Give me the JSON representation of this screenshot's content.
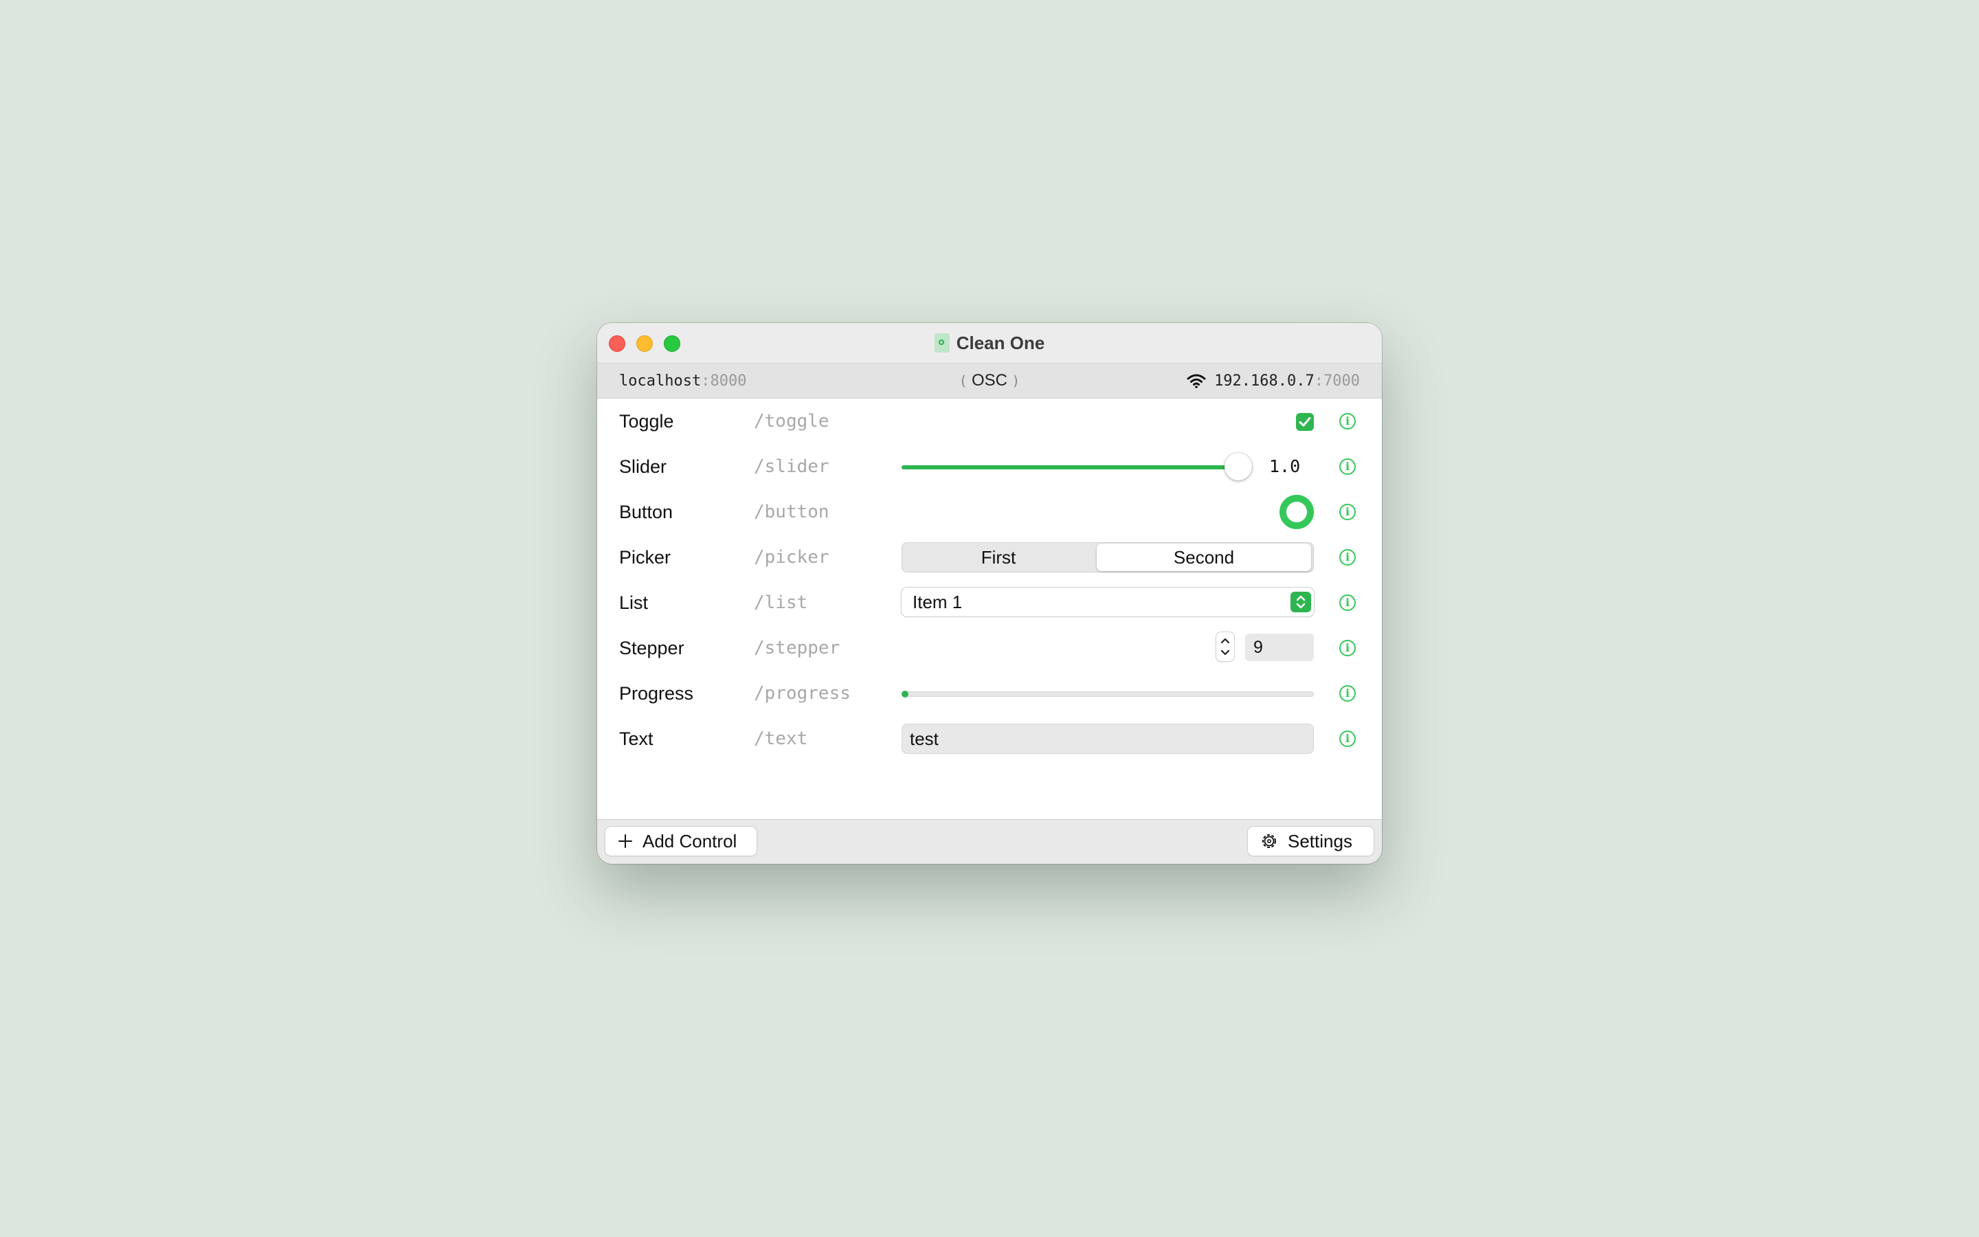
{
  "window": {
    "title": "Clean One",
    "status": {
      "local_host": "localhost",
      "local_port": ":8000",
      "protocol": "OSC",
      "remote_host": "192.168.0.7",
      "remote_port": ":7000"
    }
  },
  "controls": [
    {
      "label": "Toggle",
      "path": "/toggle",
      "type": "checkbox",
      "checked": true
    },
    {
      "label": "Slider",
      "path": "/slider",
      "type": "slider",
      "value": 1.0,
      "value_text": "1.0"
    },
    {
      "label": "Button",
      "path": "/button",
      "type": "button"
    },
    {
      "label": "Picker",
      "path": "/picker",
      "type": "segmented",
      "options": [
        "First",
        "Second"
      ],
      "selected": "Second"
    },
    {
      "label": "List",
      "path": "/list",
      "type": "popup",
      "value": "Item 1"
    },
    {
      "label": "Stepper",
      "path": "/stepper",
      "type": "stepper",
      "value": "9"
    },
    {
      "label": "Progress",
      "path": "/progress",
      "type": "progress",
      "value": 0.0
    },
    {
      "label": "Text",
      "path": "/text",
      "type": "text",
      "value": "test"
    }
  ],
  "bottom_bar": {
    "add_label": "Add Control",
    "settings_label": "Settings"
  },
  "colors": {
    "accent": "#2fb54f",
    "info": "#34c759",
    "background": "#dde6de"
  },
  "icons": [
    "document-icon",
    "osc-broadcast-icon",
    "wifi-icon",
    "info-icon",
    "checkmark-icon",
    "chevron-updown-icon",
    "plus-icon",
    "gear-icon"
  ]
}
